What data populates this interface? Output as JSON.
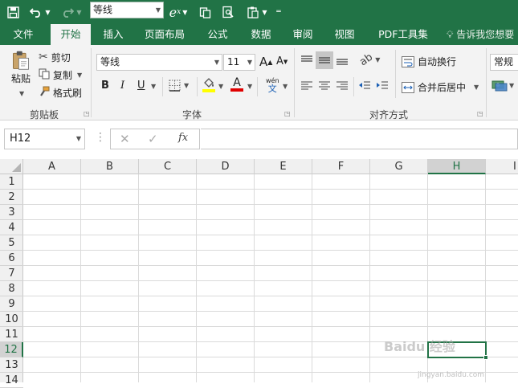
{
  "colors": {
    "excel_green": "#217346",
    "ribbon_bg": "#f3f3f3",
    "highlight_yellow": "#ffff00",
    "font_red": "#e00000"
  },
  "qat": {
    "font_combo": "等线",
    "icons": [
      "save-icon",
      "undo-icon",
      "redo-icon",
      "equation-icon",
      "copy-format-icon",
      "sheet-view-icon",
      "paste-icon",
      "customize-icon"
    ]
  },
  "tabs": [
    {
      "label": "文件"
    },
    {
      "label": "开始"
    },
    {
      "label": "插入"
    },
    {
      "label": "页面布局"
    },
    {
      "label": "公式"
    },
    {
      "label": "数据"
    },
    {
      "label": "审阅"
    },
    {
      "label": "视图"
    },
    {
      "label": "PDF工具集"
    }
  ],
  "tell_me": "告诉我您想要",
  "ribbon": {
    "clipboard": {
      "paste": "粘贴",
      "cut": "剪切",
      "copy": "复制",
      "format_painter": "格式刷",
      "label": "剪贴板"
    },
    "font": {
      "name": "等线",
      "size": "11",
      "bold": "B",
      "italic": "I",
      "underline": "U",
      "phonetic": "wén",
      "label": "字体"
    },
    "alignment": {
      "wrap": "自动换行",
      "merge": "合并后居中",
      "label": "对齐方式"
    },
    "number": {
      "format": "常规"
    }
  },
  "formula_bar": {
    "name_box": "H12",
    "fx": "fx",
    "value": ""
  },
  "grid": {
    "columns": [
      "A",
      "B",
      "C",
      "D",
      "E",
      "F",
      "G",
      "H",
      "I"
    ],
    "rows": [
      "1",
      "2",
      "3",
      "4",
      "5",
      "6",
      "7",
      "8",
      "9",
      "10",
      "11",
      "12",
      "13",
      "14"
    ],
    "selected_col": "H",
    "selected_row": "12"
  },
  "watermark": {
    "text": "Baidu 经验",
    "sub": "jingyan.baidu.com"
  }
}
